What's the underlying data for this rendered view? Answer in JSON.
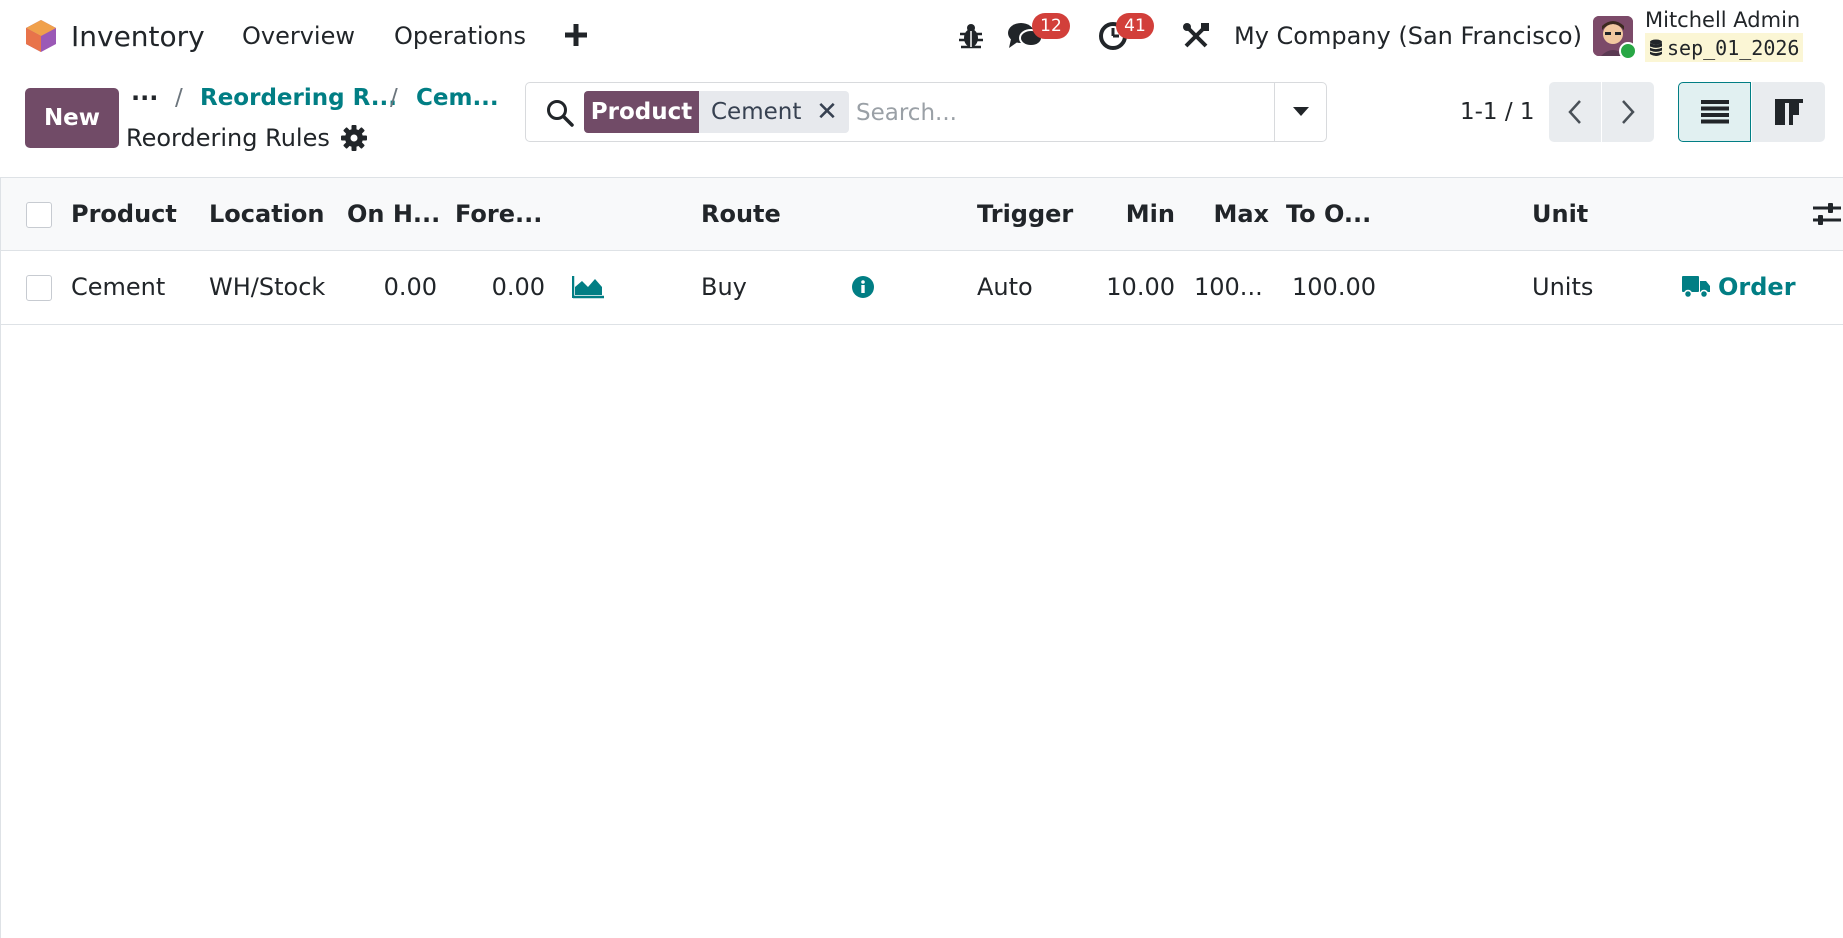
{
  "navbar": {
    "app_name": "Inventory",
    "menus": [
      "Overview",
      "Operations"
    ],
    "add_menu_icon": "plus-icon",
    "debug_icon": "bug-icon",
    "messages": {
      "icon": "chat-icon",
      "count": "12"
    },
    "activities": {
      "icon": "clock-icon",
      "count": "41"
    },
    "settings_icon": "tools-icon",
    "company": "My Company (San Francisco)",
    "user_name": "Mitchell Admin",
    "database": "sep_01_2026",
    "colors": {
      "brand": "#714b67",
      "badge": "#d23f3a",
      "link": "#017e84"
    }
  },
  "control_panel": {
    "new_label": "New",
    "breadcrumb": {
      "ellipsis": "···",
      "separator": "/",
      "items": [
        "Reordering R...",
        "Cem..."
      ]
    },
    "title": "Reordering Rules",
    "search": {
      "facet_label": "Product",
      "facet_value": "Cement",
      "remove_symbol": "✕",
      "placeholder": "Search..."
    },
    "pager": "1-1 / 1"
  },
  "list": {
    "columns": [
      "Product",
      "Location",
      "On H...",
      "Fore...",
      "Route",
      "Trigger",
      "Min",
      "Max",
      "To O...",
      "Unit"
    ],
    "rows": [
      {
        "product": "Cement",
        "location": "WH/Stock",
        "on_hand": "0.00",
        "forecast": "0.00",
        "route": "Buy",
        "trigger": "Auto",
        "min": "10.00",
        "max": "100...",
        "to_order": "100.00",
        "unit": "Units",
        "action": "Order"
      }
    ]
  }
}
